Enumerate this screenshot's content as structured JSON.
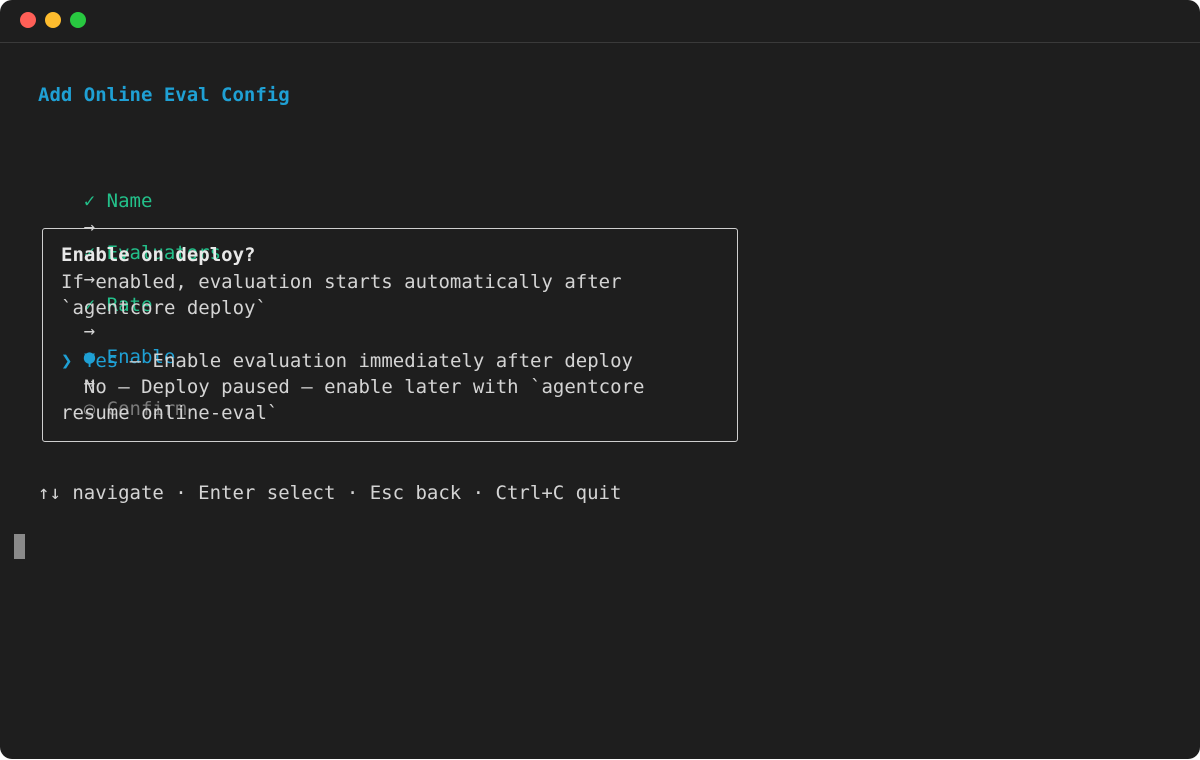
{
  "window": {
    "controls": [
      "close",
      "minimize",
      "maximize"
    ]
  },
  "title": "Add Online Eval Config",
  "steps": [
    {
      "mark": "✓",
      "label": "Name",
      "state": "done"
    },
    {
      "mark": "✓",
      "label": "Evaluators",
      "state": "done"
    },
    {
      "mark": "✓",
      "label": "Rate",
      "state": "done"
    },
    {
      "mark": "●",
      "label": "Enable",
      "state": "current"
    },
    {
      "mark": "○",
      "label": "Confirm",
      "state": "pending"
    }
  ],
  "step_separator": "→",
  "prompt": {
    "question": "Enable on deploy?",
    "description_line1": "If enabled, evaluation starts automatically after",
    "description_line2": "`agentcore deploy`",
    "options": [
      {
        "marker": "❯",
        "label": "Yes",
        "detail": " — Enable evaluation immediately after deploy",
        "selected": true
      },
      {
        "marker": " ",
        "label": "No",
        "detail": " — Deploy paused — enable later with `agentcore",
        "detail_cont": "resume online-eval`",
        "selected": false
      }
    ]
  },
  "hint": "↑↓ navigate · Enter select · Esc back · Ctrl+C quit",
  "colors": {
    "background": "#1e1e1e",
    "accent": "#1fa0d4",
    "done": "#23c08a",
    "pending": "#7a7a7a"
  }
}
